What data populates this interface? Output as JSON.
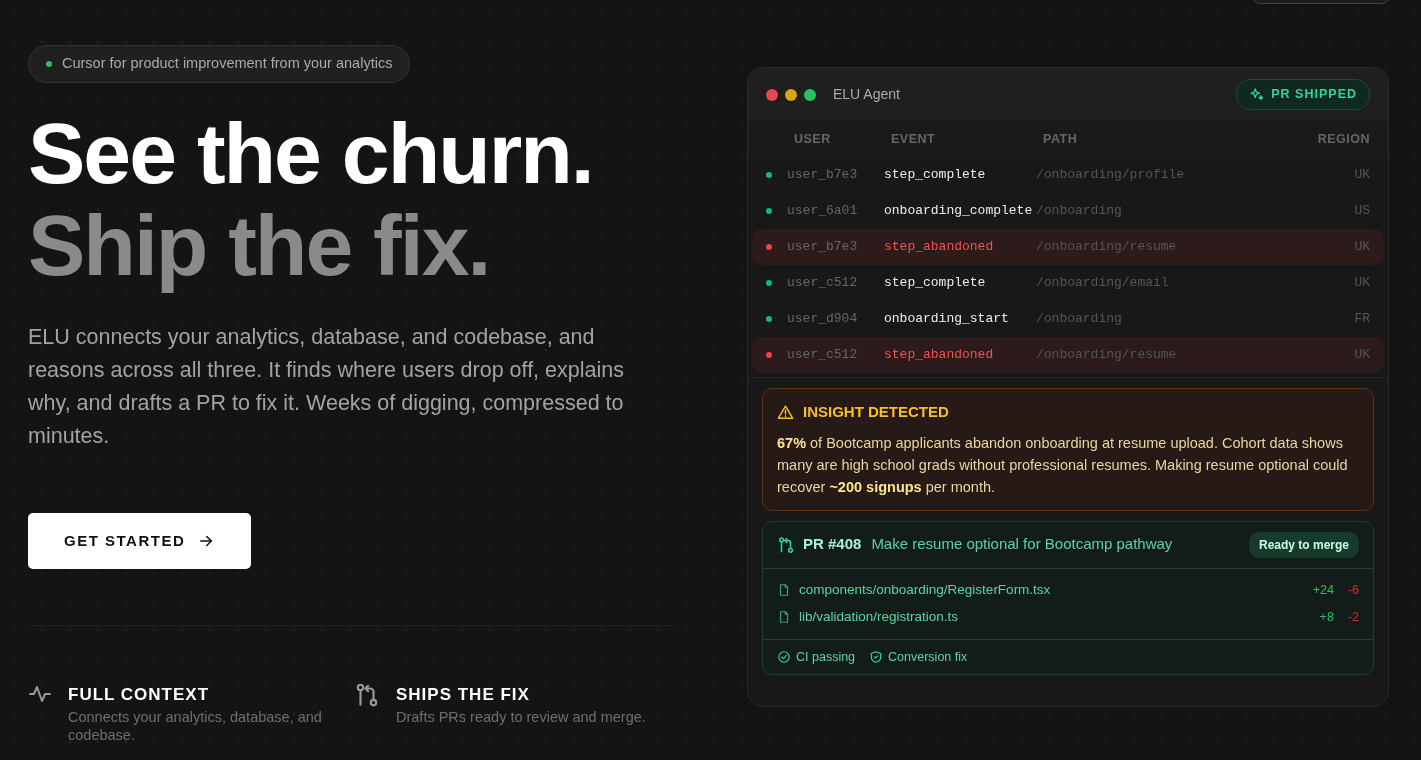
{
  "badge": {
    "text": "Cursor for product improvement from your analytics"
  },
  "headline": {
    "line_1": "See the churn.",
    "line_2": "Ship the fix."
  },
  "description": "ELU connects your analytics, database, and codebase, and reasons across all three. It finds where users drop off, explains why, and drafts a PR to fix it. Weeks of digging, compressed to minutes.",
  "cta": {
    "label": "GET STARTED"
  },
  "features": [
    {
      "title": "FULL CONTEXT",
      "text": "Connects your analytics, database, and codebase.",
      "kind": "pulse"
    },
    {
      "title": "SHIPS THE FIX",
      "text": "Drafts PRs ready to review and merge.",
      "kind": "merge"
    }
  ],
  "agent_window": {
    "title": "ELU Agent",
    "status": "PR SHIPPED",
    "table": {
      "columns": [
        "USER",
        "EVENT",
        "PATH",
        "REGION"
      ],
      "rows": [
        {
          "user": "user_b7e3",
          "event": "step_complete",
          "path": "/onboarding/profile",
          "region": "UK",
          "alert": false
        },
        {
          "user": "user_6a01",
          "event": "onboarding_complete",
          "path": "/onboarding",
          "region": "US",
          "alert": false
        },
        {
          "user": "user_b7e3",
          "event": "step_abandoned",
          "path": "/onboarding/resume",
          "region": "UK",
          "alert": true
        },
        {
          "user": "user_c512",
          "event": "step_complete",
          "path": "/onboarding/email",
          "region": "UK",
          "alert": false
        },
        {
          "user": "user_d904",
          "event": "onboarding_start",
          "path": "/onboarding",
          "region": "FR",
          "alert": false
        },
        {
          "user": "user_c512",
          "event": "step_abandoned",
          "path": "/onboarding/resume",
          "region": "UK",
          "alert": true
        }
      ]
    },
    "insight": {
      "title": "INSIGHT DETECTED",
      "text": "**67%** of Bootcamp applicants abandon onboarding at resume upload. Cohort data shows many are high school grads without professional resumes. Making resume optional could recover **~200 signups** per month."
    },
    "pr": {
      "number": "PR #408",
      "title": "Make resume optional for Bootcamp pathway",
      "status": "Ready to merge",
      "files": [
        {
          "path": "components/onboarding/RegisterForm.tsx",
          "added": "+24",
          "removed": "-6"
        },
        {
          "path": "lib/validation/registration.ts",
          "added": "+8",
          "removed": "-2"
        }
      ],
      "checks": [
        {
          "label": "CI passing",
          "kind": "check"
        },
        {
          "label": "Conversion fix",
          "kind": "shield"
        }
      ]
    }
  }
}
